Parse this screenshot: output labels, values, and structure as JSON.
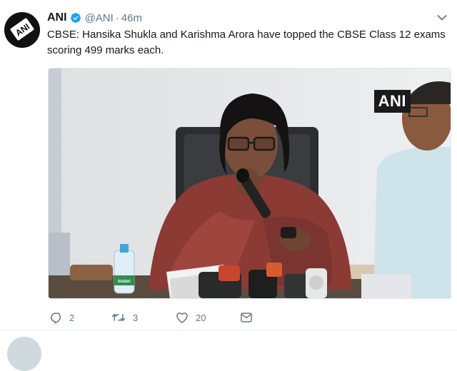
{
  "tweet": {
    "author_name": "ANI",
    "handle": "@ANI",
    "separator": "·",
    "time": "46m",
    "text": "CBSE: Hansika Shukla and Karishma Arora have topped the CBSE Class 12 exams scoring 499 marks each.",
    "avatar_text": "ANI",
    "media": {
      "watermark": "ANI",
      "bottle_label": "bisleri"
    },
    "actions": {
      "reply_count": "2",
      "retweet_count": "3",
      "like_count": "20"
    }
  },
  "icons": {
    "verified": "verified-badge-icon",
    "caret": "chevron-down-icon",
    "reply": "reply-icon",
    "retweet": "retweet-icon",
    "like": "heart-icon",
    "dm": "envelope-icon"
  },
  "colors": {
    "verified_blue": "#1da1f2",
    "secondary_text": "#657786",
    "primary_text": "#14171a"
  }
}
